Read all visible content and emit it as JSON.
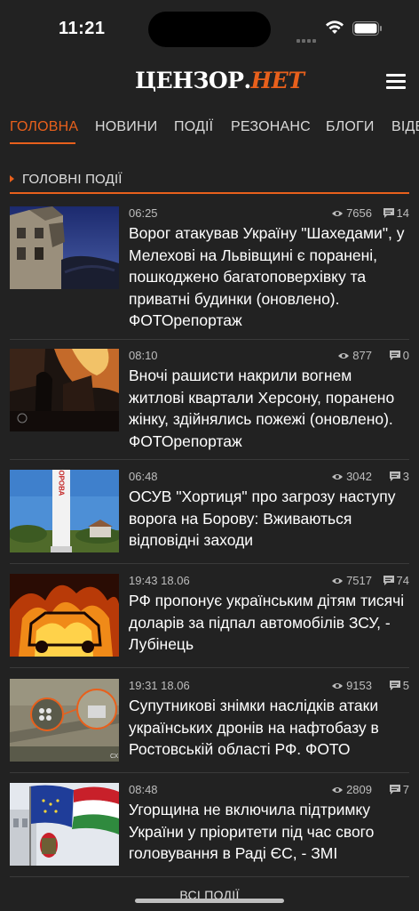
{
  "status": {
    "time": "11:21"
  },
  "header": {
    "logo_part1": "ЦЕНЗОР.",
    "logo_part2": "НЕТ"
  },
  "tabs": [
    {
      "label": "ГОЛОВНА",
      "active": true
    },
    {
      "label": "НОВИНИ",
      "active": false
    },
    {
      "label": "ПОДІЇ",
      "active": false
    },
    {
      "label": "РЕЗОНАНС",
      "active": false
    },
    {
      "label": "БЛОГИ",
      "active": false
    },
    {
      "label": "ВІДЕ",
      "active": false
    }
  ],
  "section": {
    "title": "ГОЛОВНІ ПОДІЇ"
  },
  "news": [
    {
      "time": "06:25",
      "views": "7656",
      "comments": "14",
      "title": "Ворог атакував Україну \"Шахедами\", у Мелехові на Львівщині є поранені, пошкоджено багатоповерхівку та приватні будинки (оновлено). ФОТОрепортаж"
    },
    {
      "time": "08:10",
      "views": "877",
      "comments": "0",
      "title": "Вночі рашисти накрили вогнем житлові квартали Херсону, поранено жінку, здійнялись пожежі (оновлено). ФОТОрепортаж"
    },
    {
      "time": "06:48",
      "views": "3042",
      "comments": "3",
      "title": "ОСУВ \"Хортиця\" про загрозу наступу ворога на Борову: Вживаються відповідні заходи"
    },
    {
      "time": "19:43 18.06",
      "views": "7517",
      "comments": "74",
      "title": "РФ пропонує українським дітям тисячі доларів за підпал автомобілів ЗСУ, - Лубінець"
    },
    {
      "time": "19:31 18.06",
      "views": "9153",
      "comments": "5",
      "title": "Супутникові знімки наслідків атаки українських дронів на нафтобазу в Ростовській області РФ. ФОТО"
    },
    {
      "time": "08:48",
      "views": "2809",
      "comments": "7",
      "title": "Угорщина не включила підтримку України у пріоритети під час свого головування в Раді ЄС, - ЗМІ"
    }
  ],
  "thumb_texts": {
    "borova_sign": "БОРОВА",
    "sat_corner": "СХ"
  },
  "footer": {
    "all_label": "ВСІ ПОДІЇ"
  },
  "colors": {
    "accent": "#e8601c",
    "background": "#222222"
  }
}
